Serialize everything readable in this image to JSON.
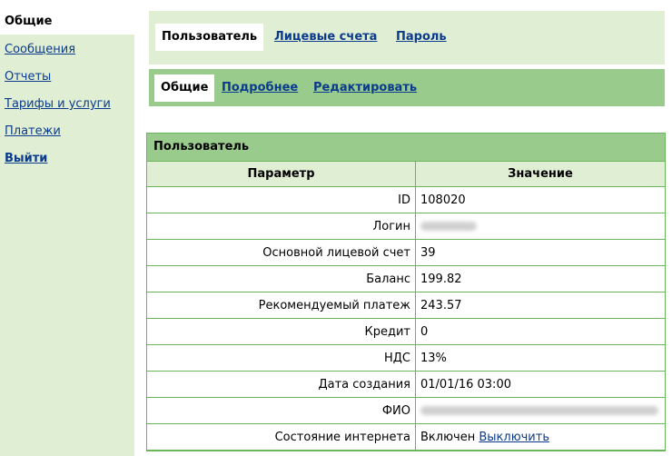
{
  "sidebar": {
    "items": [
      {
        "label": "Общие"
      },
      {
        "label": "Сообщения"
      },
      {
        "label": "Отчеты"
      },
      {
        "label": "Тарифы и услуги"
      },
      {
        "label": "Платежи"
      },
      {
        "label": "Выйти"
      }
    ]
  },
  "tabs_primary": [
    {
      "label": "Пользователь"
    },
    {
      "label": "Лицевые счета"
    },
    {
      "label": "Пароль"
    }
  ],
  "tabs_secondary": [
    {
      "label": "Общие"
    },
    {
      "label": "Подробнее"
    },
    {
      "label": "Редактировать"
    }
  ],
  "panel": {
    "title": "Пользователь",
    "columns": {
      "param": "Параметр",
      "value": "Значение"
    },
    "rows": [
      {
        "name": "ID",
        "value": "108020"
      },
      {
        "name": "Логин",
        "value": ""
      },
      {
        "name": "Основной лицевой счет",
        "value": "39"
      },
      {
        "name": "Баланс",
        "value": "199.82"
      },
      {
        "name": "Рекомендуемый платеж",
        "value": "243.57"
      },
      {
        "name": "Кредит",
        "value": "0"
      },
      {
        "name": "НДС",
        "value": "13%"
      },
      {
        "name": "Дата создания",
        "value": "01/01/16 03:00"
      },
      {
        "name": "ФИО",
        "value": ""
      },
      {
        "name": "Состояние интернета",
        "value": "Включен",
        "action": "Выключить"
      }
    ]
  },
  "colors": {
    "light_green": "#e0eed4",
    "mid_green": "#99cc8c",
    "border_green": "#6ab55c",
    "link_blue": "#0b3b8c"
  }
}
